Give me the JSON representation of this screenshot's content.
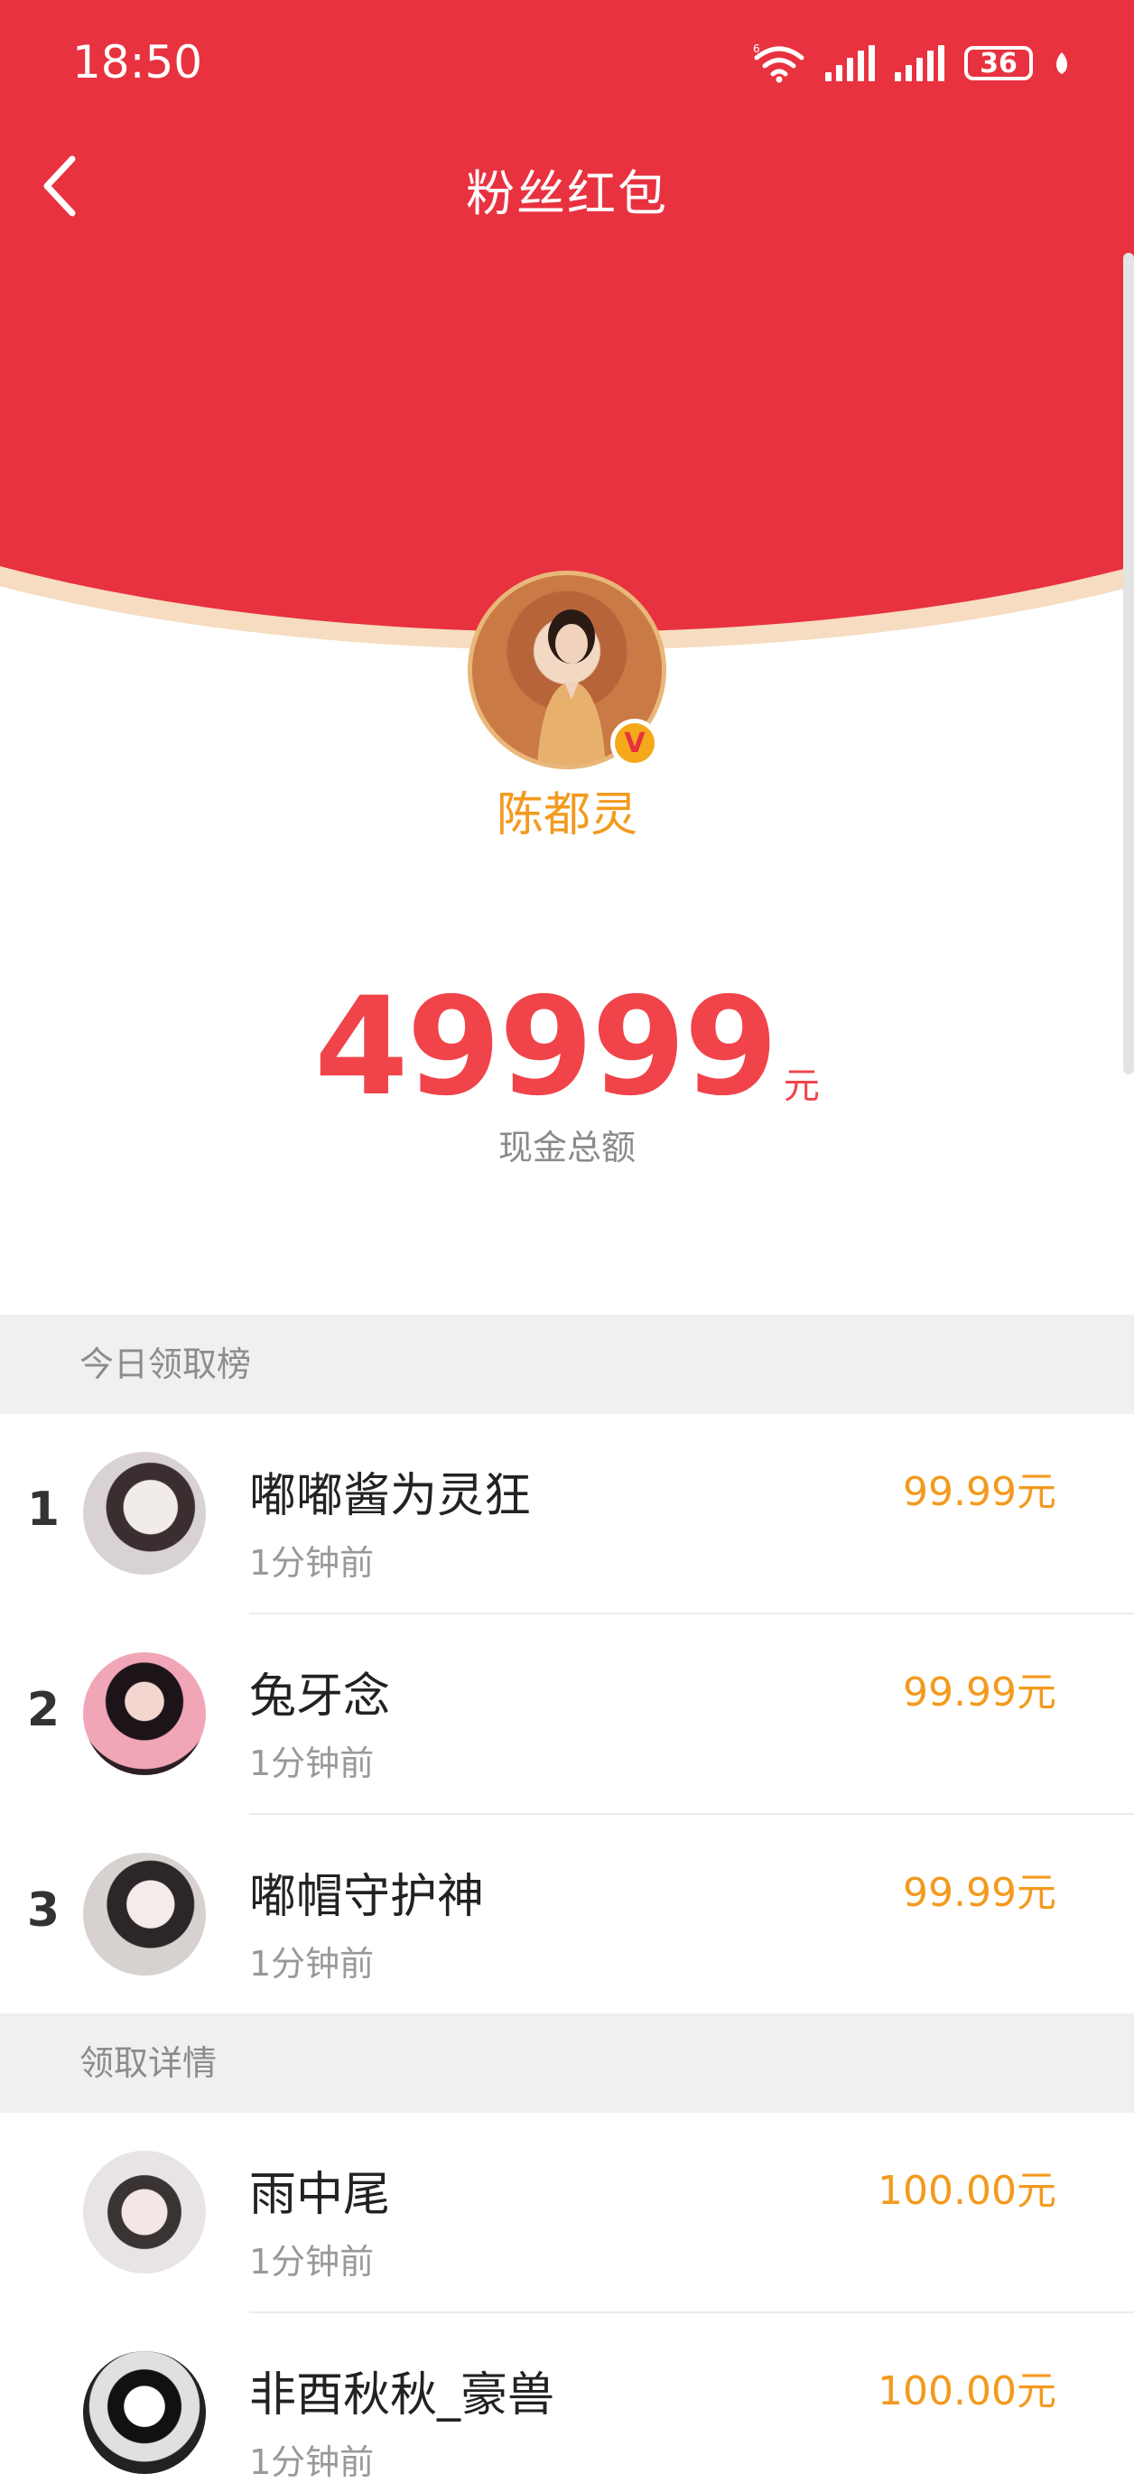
{
  "status_bar": {
    "time": "18:50",
    "battery": "36",
    "network_badge": "6"
  },
  "header": {
    "title": "粉丝红包"
  },
  "host": {
    "name": "陈都灵",
    "verified_badge": "V"
  },
  "total": {
    "amount": "49999",
    "unit": "元",
    "label": "现金总额"
  },
  "leaderboard": {
    "section_title": "今日领取榜",
    "rows": [
      {
        "rank": "1",
        "name": "嘟嘟酱为灵狂",
        "time": "1分钟前",
        "amount": "99.99元"
      },
      {
        "rank": "2",
        "name": "兔牙念",
        "time": "1分钟前",
        "amount": "99.99元"
      },
      {
        "rank": "3",
        "name": "嘟帽守护神",
        "time": "1分钟前",
        "amount": "99.99元"
      }
    ]
  },
  "details": {
    "section_title": "领取详情",
    "rows": [
      {
        "name": "雨中尾",
        "time": "1分钟前",
        "amount": "100.00元"
      },
      {
        "name": "非酉秋秋_豪兽",
        "time": "1分钟前",
        "amount": "100.00元"
      }
    ]
  },
  "colors": {
    "header_red": "#e8323f",
    "amount_red": "#f0434a",
    "accent_orange": "#f39a1e"
  }
}
